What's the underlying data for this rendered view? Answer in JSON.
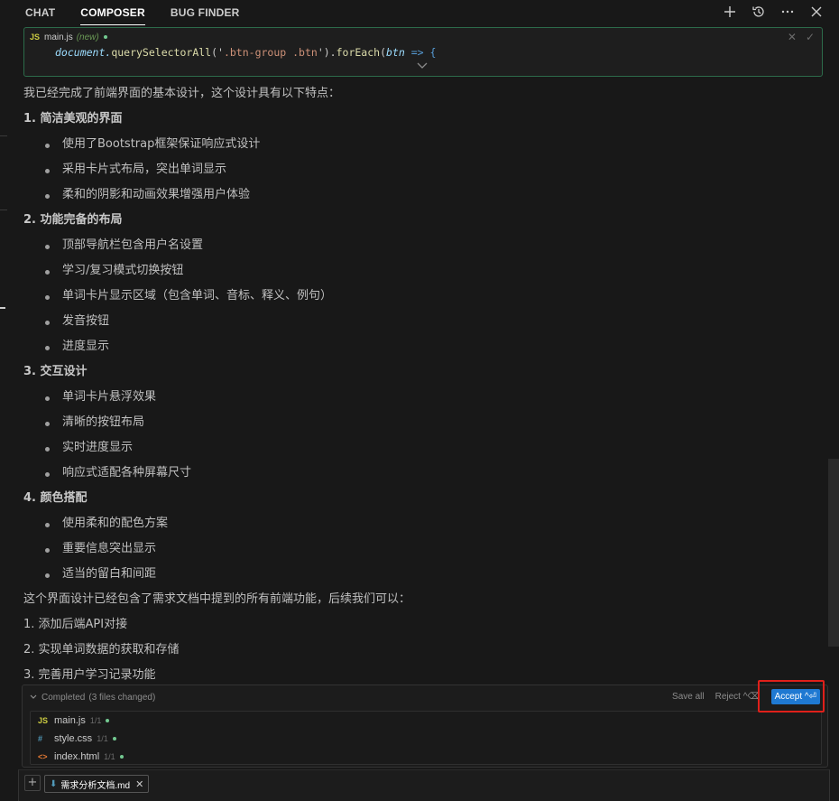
{
  "tabs": [
    {
      "label": "CHAT"
    },
    {
      "label": "COMPOSER"
    },
    {
      "label": "BUG FINDER"
    }
  ],
  "tab_icons": [
    "plus-icon",
    "history-icon",
    "more-icon",
    "close-icon"
  ],
  "code_block": {
    "badge": "JS",
    "filename": "main.js",
    "status": "(new)",
    "line1_a": "document.",
    "line1_b": "querySelectorAll",
    "line1_c": "('",
    "line1_d": ".btn-group .btn",
    "line1_e": "').",
    "line1_f": "forEach",
    "line1_g": "(",
    "line1_h": "btn",
    "line1_i": " => {"
  },
  "content": {
    "intro": "我已经完成了前端界面的基本设计，这个设计具有以下特点：",
    "sections": [
      {
        "title": "1. 简洁美观的界面",
        "items": [
          "使用了Bootstrap框架保证响应式设计",
          "采用卡片式布局，突出单词显示",
          "柔和的阴影和动画效果增强用户体验"
        ]
      },
      {
        "title": "2. 功能完备的布局",
        "items": [
          "顶部导航栏包含用户名设置",
          "学习/复习模式切换按钮",
          "单词卡片显示区域（包含单词、音标、释义、例句）",
          "发音按钮",
          "进度显示"
        ]
      },
      {
        "title": "3. 交互设计",
        "items": [
          "单词卡片悬浮效果",
          "清晰的按钮布局",
          "实时进度显示",
          "响应式适配各种屏幕尺寸"
        ]
      },
      {
        "title": "4. 颜色搭配",
        "items": [
          "使用柔和的配色方案",
          "重要信息突出显示",
          "适当的留白和间距"
        ]
      }
    ],
    "outro": "这个界面设计已经包含了需求文档中提到的所有前端功能，后续我们可以：",
    "next_steps": [
      "1. 添加后端API对接",
      "2. 实现单词数据的获取和存储",
      "3. 完善用户学习记录功能"
    ]
  },
  "panel": {
    "status": "Completed",
    "changes": "(3 files changed)",
    "save_all": "Save all",
    "reject": "Reject ^⌫",
    "accept": "Accept ^⏎",
    "files": [
      {
        "icon": "JS",
        "name": "main.js",
        "count": "1/1"
      },
      {
        "icon": "#",
        "name": "style.css",
        "count": "1/1"
      },
      {
        "icon": "<>",
        "name": "index.html",
        "count": "1/1"
      }
    ]
  },
  "bottom": {
    "add": "+",
    "chip_name": "需求分析文档.md",
    "chip_icon": "⬇",
    "chip_close": "✕"
  }
}
